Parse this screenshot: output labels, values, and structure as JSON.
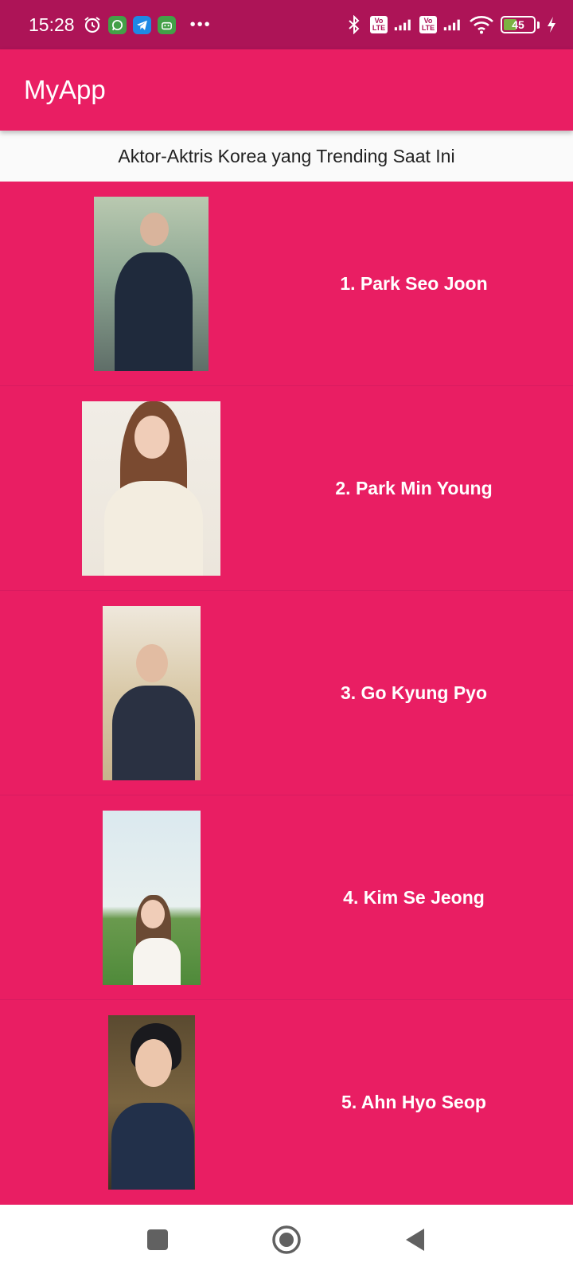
{
  "status_bar": {
    "time": "15:28",
    "battery_level": "45",
    "battery_fraction": 0.45,
    "icons": [
      "alarm-icon",
      "whatsapp-icon",
      "telegram-icon",
      "android-app-icon",
      "more-dots-icon",
      "bluetooth-icon",
      "volte-icon",
      "signal-icon",
      "wifi-icon",
      "battery-icon",
      "charging-icon"
    ],
    "volte_label": "Vo LTE",
    "more_label": "•••"
  },
  "app_bar": {
    "title": "MyApp"
  },
  "header": {
    "subtitle": "Aktor-Aktris Korea yang Trending Saat Ini"
  },
  "actors": [
    {
      "label": "1. Park Seo Joon"
    },
    {
      "label": "2. Park Min Young"
    },
    {
      "label": "3. Go Kyung Pyo"
    },
    {
      "label": "4. Kim Se Jeong"
    },
    {
      "label": "5. Ahn Hyo Seop"
    }
  ],
  "nav_bar": {
    "icons": [
      "recents-square-icon",
      "home-circle-icon",
      "back-triangle-icon"
    ]
  },
  "colors": {
    "primary": "#e91e63",
    "primary_dark": "#ad1457",
    "text_on_primary": "#ffffff"
  }
}
